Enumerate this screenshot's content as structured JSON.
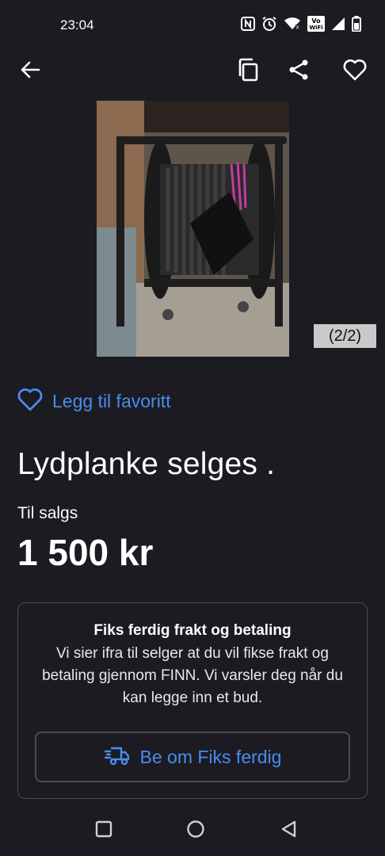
{
  "status_bar": {
    "time": "23:04",
    "icons": [
      "nfc-icon",
      "alarm-icon",
      "wifi-icon",
      "vowifi-icon",
      "signal-icon",
      "battery-icon"
    ],
    "vowifi_label": "VoWiFi"
  },
  "toolbar": {
    "back_icon": "arrow-left-icon",
    "copy_icon": "copy-icon",
    "share_icon": "share-icon",
    "favorite_icon": "heart-outline-icon"
  },
  "gallery": {
    "counter": "(2/2)",
    "image": "cable-reel-photo"
  },
  "favorite": {
    "label": "Legg til favoritt"
  },
  "listing": {
    "title": "Lydplanke selges .",
    "sale_type": "Til salgs",
    "price": "1 500 kr"
  },
  "shipping_card": {
    "title": "Fiks ferdig frakt og betaling",
    "body": "Vi sier ifra til selger at du vil fikse frakt og betaling gjennom FINN. Vi varsler deg når du kan legge inn et bud.",
    "button_label": "Be om Fiks ferdig",
    "button_icon": "delivery-truck-icon"
  },
  "colors": {
    "background": "#1b1b21",
    "accent": "#4a8cf0",
    "border": "#4a4a52"
  },
  "nav_bar": {
    "icons": [
      "recents-square-icon",
      "home-circle-icon",
      "back-triangle-icon"
    ]
  }
}
